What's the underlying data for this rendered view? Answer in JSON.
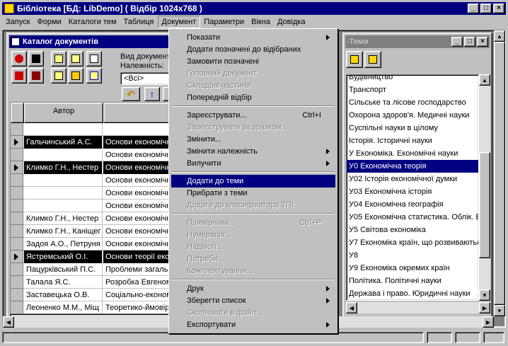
{
  "window": {
    "title": "Бібліотека [БД: LibDemo]  ( Відбір 1024x768 )"
  },
  "menubar": [
    "Запуск",
    "Форми",
    "Каталоги тем",
    "Таблиця",
    "Документ",
    "Параметри",
    "Вікна",
    "Довідка"
  ],
  "catalog": {
    "title": "Каталог документів",
    "vid_label": "Вид документ",
    "nalezh_label": "Належність:",
    "select_value": "<Всі>",
    "column_author": "Автор",
    "rows": [
      {
        "author": "",
        "title": "",
        "selected": false
      },
      {
        "author": "Гальчинський А.С.",
        "title": "Основи економічної",
        "selected": true
      },
      {
        "author": "",
        "title": "Основи економічної",
        "selected": false
      },
      {
        "author": "Климко Г.Н., Нестер",
        "title": "Основи економічної",
        "selected": true
      },
      {
        "author": "",
        "title": "Основи економічної",
        "selected": false
      },
      {
        "author": "",
        "title": "Основи економічної",
        "selected": false
      },
      {
        "author": "",
        "title": "Основи економічної",
        "selected": false
      },
      {
        "author": "Климко Г.Н., Нестер",
        "title": "Основи економічної",
        "selected": false
      },
      {
        "author": "Климко Г.Н., Каніщег",
        "title": "Основи економічної",
        "selected": false
      },
      {
        "author": "Задоя А.О., Петруня",
        "title": "Основи економічної",
        "selected": false
      },
      {
        "author": "Ястремський О.І.",
        "title": "Основи теорії економ",
        "selected": true
      },
      {
        "author": "Пацурківський П.С.",
        "title": "Проблеми загальн",
        "selected": false
      },
      {
        "author": "Талала Я.С.",
        "title": "Розробка Евгеном",
        "selected": false
      },
      {
        "author": "Заставецька О.В.",
        "title": "Соціально-економ",
        "selected": false
      },
      {
        "author": "Леоненко М.М., Міщ",
        "title": "Теоретико-ймовір",
        "selected": false
      }
    ]
  },
  "themes": {
    "title": "-Теми",
    "items": [
      {
        "label": "Будівництво",
        "selected": false
      },
      {
        "label": "Транспорт",
        "selected": false
      },
      {
        "label": "Сільське та лісове господарство",
        "selected": false
      },
      {
        "label": "Охорона здоров'я. Медичні науки",
        "selected": false
      },
      {
        "label": "Суспільні науки в цілому",
        "selected": false
      },
      {
        "label": "Історія. Історичні науки",
        "selected": false
      },
      {
        "label": "У Економіка. Економічні науки",
        "selected": false
      },
      {
        "label": "У0 Економічна теорія",
        "selected": true
      },
      {
        "label": "У02 Історія економічної думки",
        "selected": false
      },
      {
        "label": "У03 Економічна історія",
        "selected": false
      },
      {
        "label": "У04 Економічна географія",
        "selected": false
      },
      {
        "label": "У05 Економічна статистика. Облік. Ек",
        "selected": false
      },
      {
        "label": "У5 Світова економіка",
        "selected": false
      },
      {
        "label": "У7 Економіка країн, що розвиваютьс",
        "selected": false
      },
      {
        "label": "У8",
        "selected": false
      },
      {
        "label": "У9 Економіка окремих країн",
        "selected": false
      },
      {
        "label": "Політика. Політичні науки",
        "selected": false
      },
      {
        "label": "Держава і право. Юридичні науки",
        "selected": false
      }
    ]
  },
  "dropdown": [
    {
      "label": "Показати",
      "disabled": false,
      "submenu": true,
      "shortcut": ""
    },
    {
      "label": "Додати позначені до відібраних",
      "disabled": false,
      "submenu": false,
      "shortcut": ""
    },
    {
      "label": "Замовити позначені",
      "disabled": false,
      "submenu": false,
      "shortcut": ""
    },
    {
      "label": "Головний документ",
      "disabled": true,
      "submenu": false,
      "shortcut": ""
    },
    {
      "label": "Складові частини",
      "disabled": true,
      "submenu": false,
      "shortcut": ""
    },
    {
      "label": "Попередній відбір",
      "disabled": false,
      "submenu": false,
      "shortcut": ""
    },
    {
      "sep": true
    },
    {
      "label": "Зареєструвати...",
      "disabled": false,
      "submenu": false,
      "shortcut": "Ctrl+I"
    },
    {
      "label": "Зареєструвати за зразком...",
      "disabled": true,
      "submenu": false,
      "shortcut": ""
    },
    {
      "label": "Змінити...",
      "disabled": false,
      "submenu": false,
      "shortcut": ""
    },
    {
      "label": "Змінити належність",
      "disabled": false,
      "submenu": true,
      "shortcut": ""
    },
    {
      "label": "Вилучити",
      "disabled": false,
      "submenu": true,
      "shortcut": ""
    },
    {
      "sep": true
    },
    {
      "label": "Додати до теми",
      "disabled": false,
      "submenu": false,
      "shortcut": "",
      "highlighted": true
    },
    {
      "label": "Прибрати з теми",
      "disabled": false,
      "submenu": false,
      "shortcut": ""
    },
    {
      "label": "Додати до класифікатора ТПІ",
      "disabled": true,
      "submenu": false,
      "shortcut": ""
    },
    {
      "sep": true
    },
    {
      "label": "Примірники...",
      "disabled": true,
      "submenu": false,
      "shortcut": "Ctrl+P"
    },
    {
      "label": "Нумерація...",
      "disabled": true,
      "submenu": false,
      "shortcut": ""
    },
    {
      "label": "Надвісті...",
      "disabled": true,
      "submenu": false,
      "shortcut": ""
    },
    {
      "label": "Потреби...",
      "disabled": true,
      "submenu": false,
      "shortcut": ""
    },
    {
      "label": "Комплектування...",
      "disabled": true,
      "submenu": false,
      "shortcut": ""
    },
    {
      "sep": true
    },
    {
      "label": "Друк",
      "disabled": false,
      "submenu": true,
      "shortcut": ""
    },
    {
      "label": "Зберегти список",
      "disabled": false,
      "submenu": true,
      "shortcut": ""
    },
    {
      "label": "Скопіювати в файл...",
      "disabled": true,
      "submenu": false,
      "shortcut": ""
    },
    {
      "label": "Експортувати",
      "disabled": false,
      "submenu": true,
      "shortcut": ""
    }
  ]
}
